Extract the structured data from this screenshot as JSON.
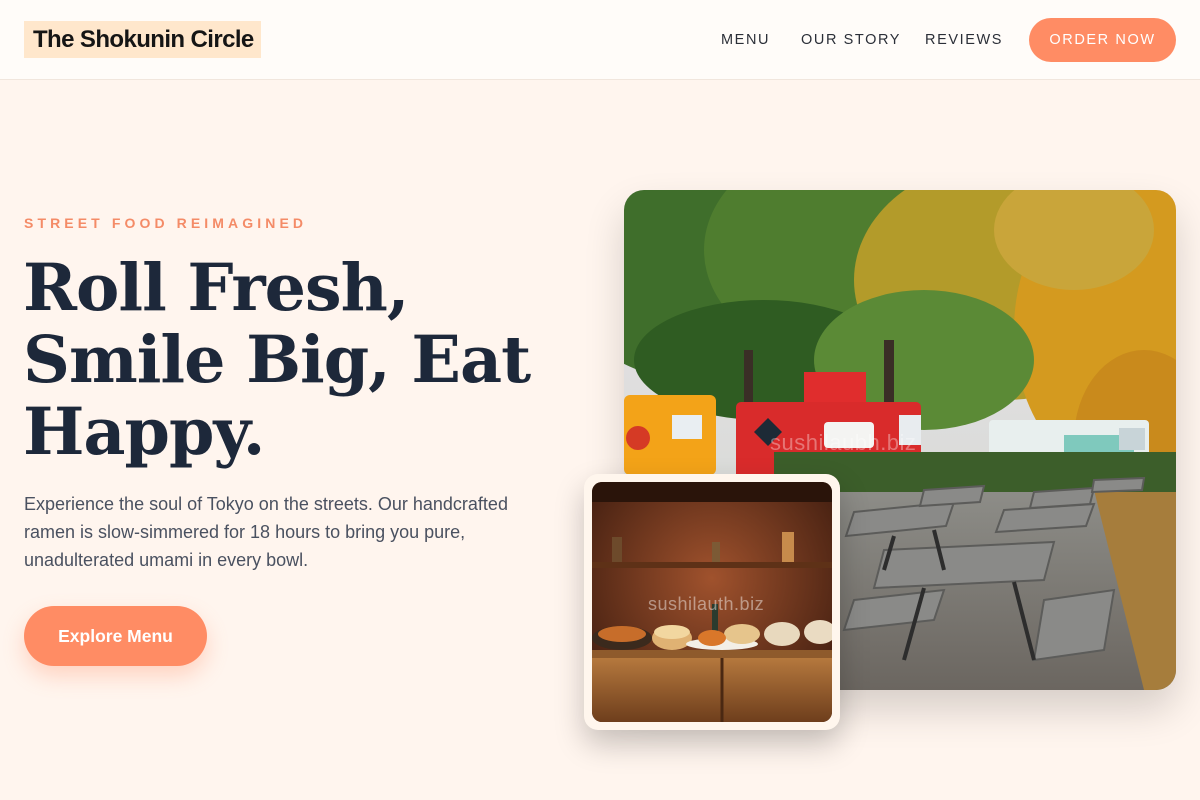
{
  "header": {
    "logo": "The Shokunin Circle",
    "nav": [
      "MENU",
      "OUR STORY",
      "REVIEWS"
    ],
    "cta": "ORDER NOW"
  },
  "hero": {
    "eyebrow": "STREET FOOD REIMAGINED",
    "title": "Roll Fresh, Smile Big, Eat Happy.",
    "body": "Experience the soul of Tokyo on the streets. Our handcrafted ramen is slow-simmered for 18 hours to bring you pure, unadulterated umami in every bowl.",
    "button": "Explore Menu"
  },
  "images": {
    "main_watermark": "sushilaubh.biz",
    "inset_watermark": "sushilauth.biz"
  },
  "colors": {
    "accent": "#ff8c64",
    "background": "#fff5ee",
    "heading": "#1d283a",
    "logo_highlight": "#ffe7cc"
  },
  "icons": [
    "food-truck-park-photo",
    "food-platter-photo"
  ]
}
